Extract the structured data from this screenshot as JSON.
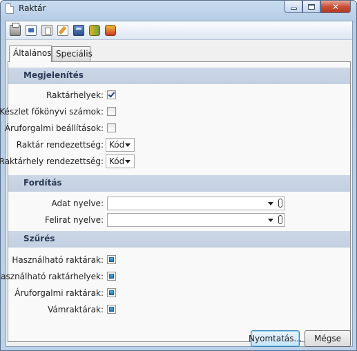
{
  "window": {
    "title": "Raktár"
  },
  "toolbar": {
    "icons": [
      "print-icon",
      "preview-icon",
      "copy-icon",
      "edit-icon",
      "calculator-icon",
      "database-icon",
      "database-export-icon"
    ]
  },
  "tabs": [
    {
      "label": "Általános",
      "active": true
    },
    {
      "label": "Speciális",
      "active": false
    }
  ],
  "sections": {
    "display": {
      "title": "Megjelenítés",
      "warehouses": {
        "label": "Raktárhelyek:",
        "checked": true
      },
      "ledger_accounts": {
        "label": "Készlet főkönyvi számok:",
        "checked": false
      },
      "trade_settings": {
        "label": "Áruforgalmi beállítások:",
        "checked": false
      },
      "warehouse_order": {
        "label": "Raktár rendezettség:",
        "value": "Kód"
      },
      "location_order": {
        "label": "Raktárhely rendezettség:",
        "value": "Kód"
      }
    },
    "translation": {
      "title": "Fordítás",
      "data_language": {
        "label": "Adat nyelve:",
        "value": ""
      },
      "caption_language": {
        "label": "Felirat nyelve:",
        "value": ""
      }
    },
    "filter": {
      "title": "Szűrés",
      "usable_warehouses": {
        "label": "Használható raktárak:"
      },
      "usable_locations": {
        "label": "Használható raktárhelyek:"
      },
      "trade_warehouses": {
        "label": "Áruforgalmi raktárak:"
      },
      "customs_warehouses": {
        "label": "Vámraktárak:"
      }
    }
  },
  "buttons": {
    "print": "Nyomtatás...",
    "cancel": "Mégse"
  },
  "colors": {
    "section_header": "#c6d3e4",
    "frame": "#b9cfe9",
    "close_button": "#c8513a"
  }
}
